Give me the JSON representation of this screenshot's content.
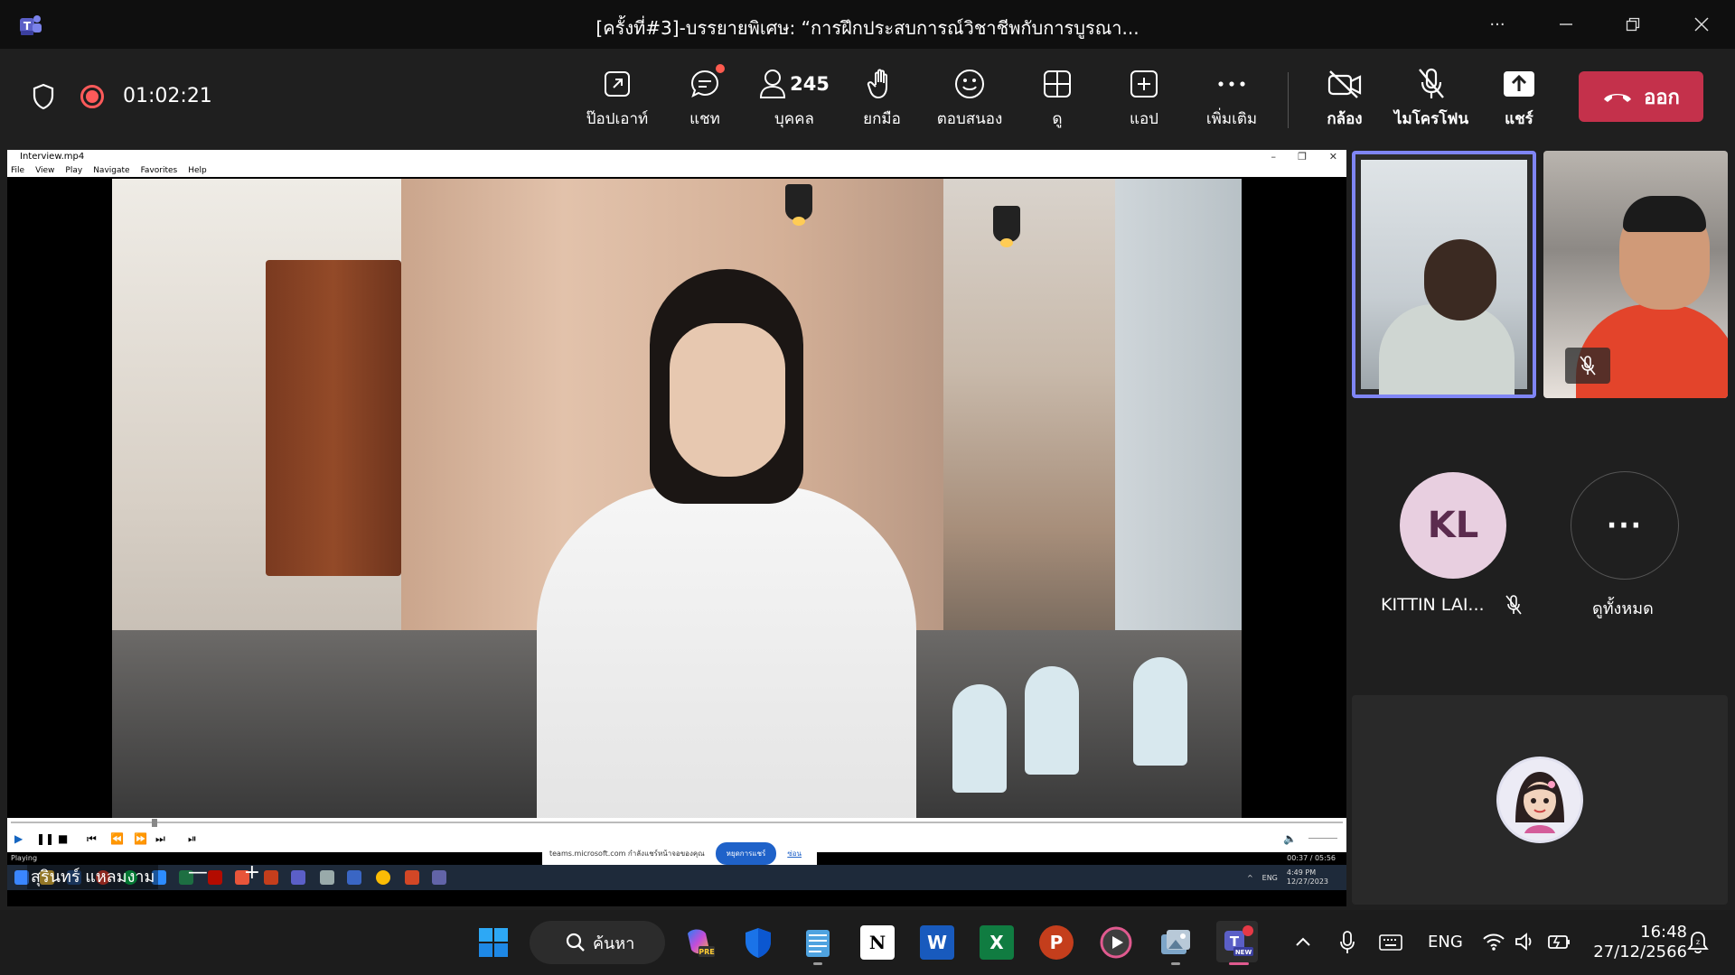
{
  "window": {
    "title": "[ครั้งที่#3]-บรรยายพิเศษ: “การฝึกประสบการณ์วิชาชีพกับการบูรณา...",
    "more": "···"
  },
  "meeting": {
    "timer": "01:02:21",
    "toolbar": {
      "popout": "ป๊อปเอาท์",
      "chat": "แชท",
      "people": "บุคคล",
      "people_count": "245",
      "raise_hand": "ยกมือ",
      "react": "ตอบสนอง",
      "view": "ดู",
      "apps": "แอป",
      "more": "เพิ่มเติม",
      "camera": "กล้อง",
      "mic": "ไมโครโฟน",
      "share": "แชร์",
      "leave": "ออก"
    }
  },
  "shared_screen": {
    "player_title": "Interview.mp4",
    "menu": [
      "File",
      "View",
      "Play",
      "Navigate",
      "Favorites",
      "Help"
    ],
    "time": "00:37 / 05:56",
    "status_left": "Playing",
    "share_notice": {
      "text": "teams.microsoft.com กำลังแชร์หน้าจอของคุณ",
      "stop": "หยุดการแชร์",
      "hide": "ซ่อน"
    },
    "presenter_name": "สุรินทร์ แหลมงาม",
    "zoom_minus": "—",
    "zoom_plus": "+",
    "inner_clock_time": "4:49 PM",
    "inner_clock_date": "12/27/2023",
    "inner_lang": "ENG"
  },
  "participants": {
    "kl_initials": "KL",
    "kl_name": "KITTIN LAI...",
    "view_all_label": "ดูทั้งหมด",
    "view_all_icon": "···"
  },
  "taskbar": {
    "search_label": "ค้นหา",
    "lang": "ENG",
    "time": "16:48",
    "date": "27/12/2566",
    "icons": [
      "windows-start",
      "search",
      "copilot-pre",
      "defender",
      "notepad",
      "notion",
      "word",
      "excel",
      "powerpoint",
      "media-player",
      "photos",
      "teams-new"
    ]
  },
  "colors": {
    "leave_red": "#c4314b",
    "active_tile_border": "#7f85f5",
    "recording": "#ff5a5a"
  }
}
